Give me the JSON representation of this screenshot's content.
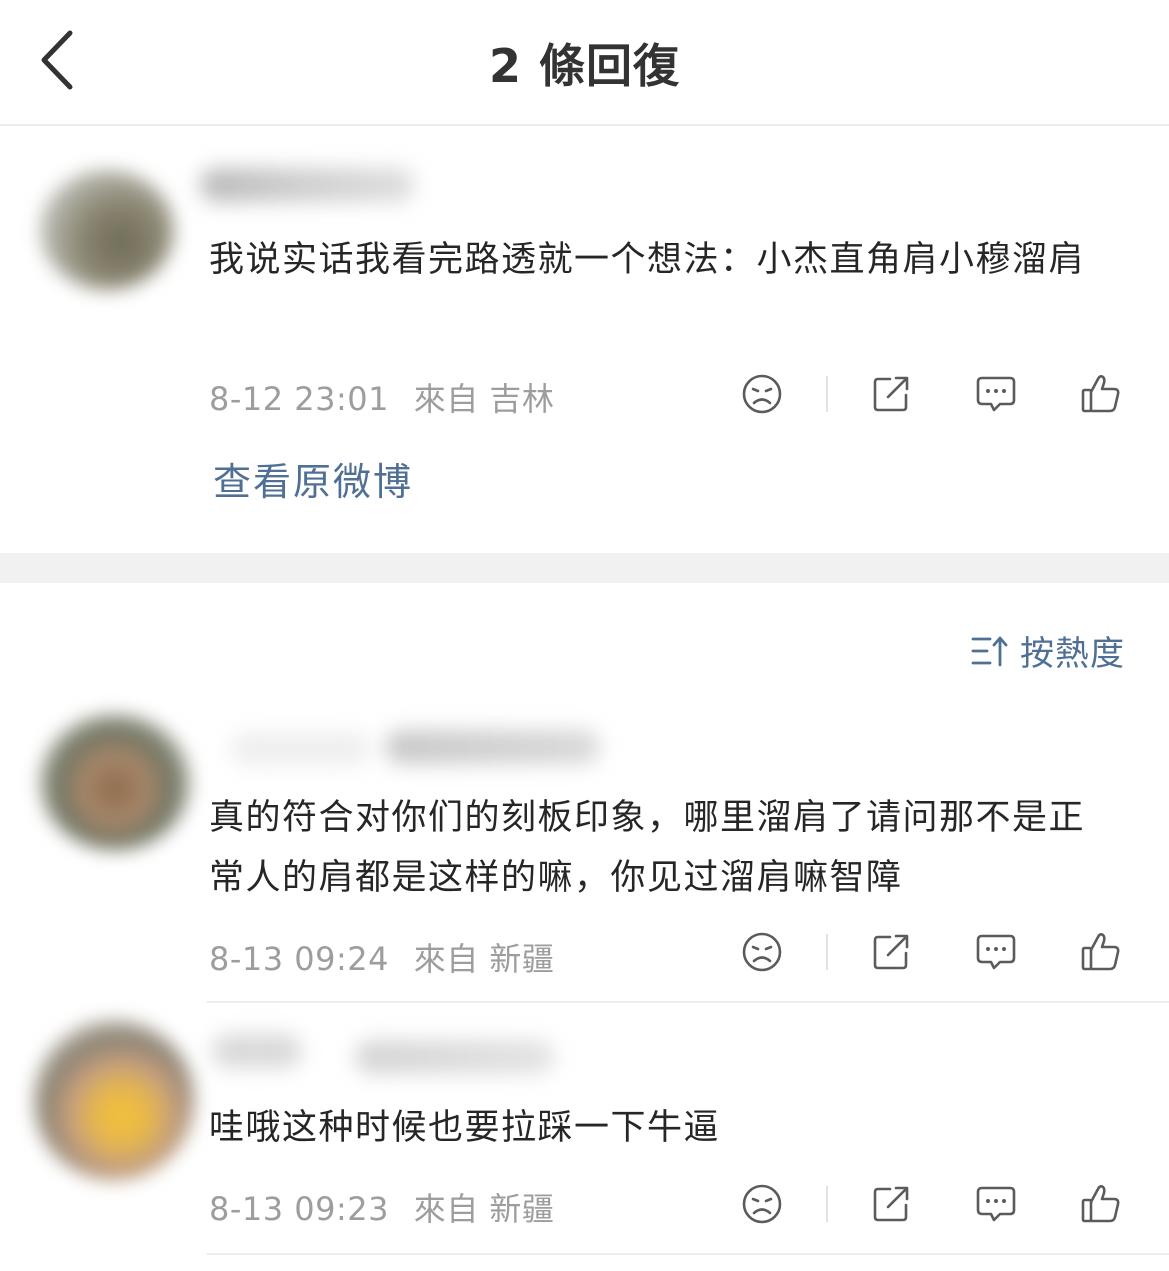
{
  "header": {
    "title": "2 條回復"
  },
  "origin": {
    "text": "我说实话我看完路透就一个想法：小杰直角肩小穆溜肩",
    "time": "8-12 23:01",
    "source": "來自 吉林",
    "view_origin_label": "查看原微博"
  },
  "sort": {
    "label": "按熱度"
  },
  "replies": [
    {
      "text": "真的符合对你们的刻板印象，哪里溜肩了请问那不是正常人的肩都是这样的嘛，你见过溜肩嘛智障",
      "time": "8-13 09:24",
      "source": "來自 新疆"
    },
    {
      "text": "哇哦这种时候也要拉踩一下牛逼",
      "time": "8-13 09:23",
      "source": "來自 新疆"
    }
  ],
  "icons": {
    "back": "chevron-left-icon",
    "dislike": "sad-face-icon",
    "share": "share-icon",
    "comment": "comment-bubble-icon",
    "like": "thumbs-up-icon",
    "sort": "sort-icon"
  },
  "colors": {
    "link": "#4f6f95",
    "meta": "#9d9d9d",
    "text": "#262626",
    "band": "#f1f1f1"
  }
}
